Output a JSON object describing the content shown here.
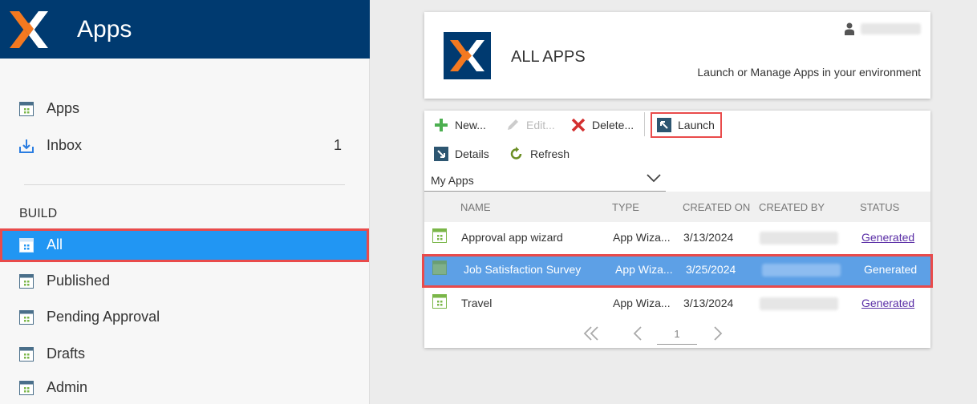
{
  "sidebar": {
    "title": "Apps",
    "items": [
      {
        "label": "Apps",
        "icon": "app-grid-icon"
      },
      {
        "label": "Inbox",
        "icon": "inbox-download-icon",
        "count": "1"
      }
    ],
    "section": "BUILD",
    "build_items": [
      {
        "label": "All",
        "active": true
      },
      {
        "label": "Published"
      },
      {
        "label": "Pending Approval"
      },
      {
        "label": "Drafts"
      },
      {
        "label": "Admin"
      }
    ]
  },
  "header": {
    "title": "ALL APPS",
    "subtitle": "Launch or Manage Apps in your environment"
  },
  "toolbar": {
    "new": "New...",
    "edit": "Edit...",
    "delete": "Delete...",
    "launch": "Launch",
    "details": "Details",
    "refresh": "Refresh"
  },
  "filter": {
    "selected": "My Apps"
  },
  "table": {
    "columns": [
      "NAME",
      "TYPE",
      "CREATED ON",
      "CREATED BY",
      "STATUS"
    ],
    "rows": [
      {
        "name": "Approval app wizard",
        "type": "App Wiza...",
        "created_on": "3/13/2024",
        "status": "Generated"
      },
      {
        "name": "Job Satisfaction Survey",
        "type": "App Wiza...",
        "created_on": "3/25/2024",
        "status": "Generated"
      },
      {
        "name": "Travel",
        "type": "App Wiza...",
        "created_on": "3/13/2024",
        "status": "Generated"
      }
    ]
  },
  "pager": {
    "page": "1"
  },
  "colors": {
    "header_bg": "#003a70",
    "logo_orange": "#f47920",
    "active_blue": "#2196f3",
    "selected_row": "#5da0e6",
    "highlight_red": "#e94b4b",
    "link_purple": "#5a2ea6"
  }
}
